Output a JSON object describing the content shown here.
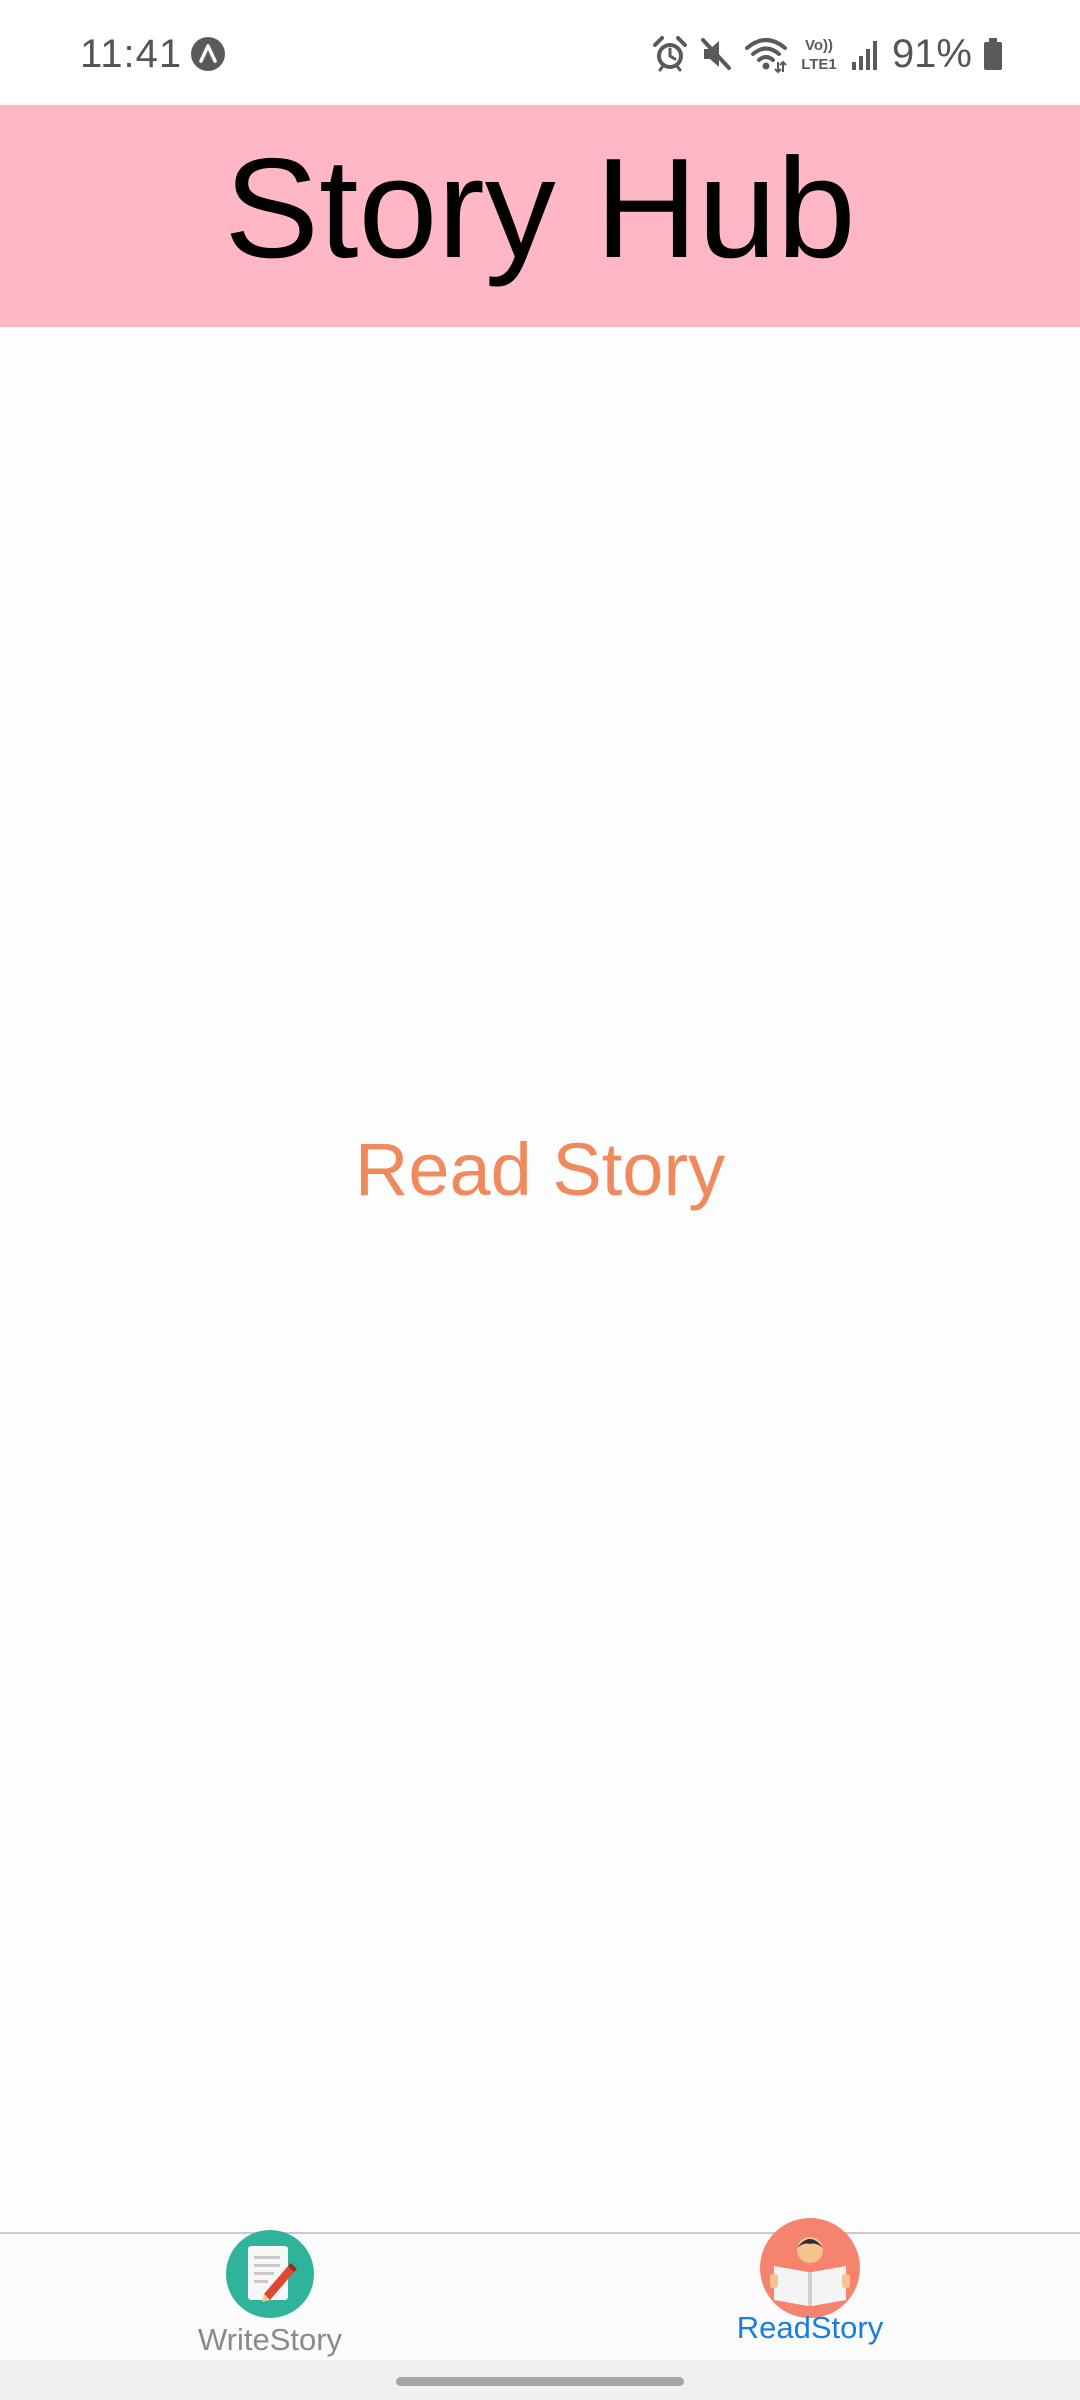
{
  "status_bar": {
    "time": "11:41",
    "battery_percent": "91%",
    "network_label_top": "Vo))",
    "network_label_bottom": "LTE1",
    "icons": [
      "app-notification-icon",
      "alarm-icon",
      "mute-icon",
      "wifi-icon",
      "signal-icon",
      "battery-icon"
    ]
  },
  "header": {
    "title": "Story Hub",
    "background": "#ffb7c6"
  },
  "main": {
    "screen_text": "Read Story",
    "text_color": "#f08a5d"
  },
  "tabs": [
    {
      "label": "WriteStory",
      "icon": "write-story-icon",
      "active": false
    },
    {
      "label": "ReadStory",
      "icon": "read-story-icon",
      "active": true
    }
  ],
  "colors": {
    "active_tab": "#1a7de0",
    "inactive_tab": "#8a8a8a"
  }
}
